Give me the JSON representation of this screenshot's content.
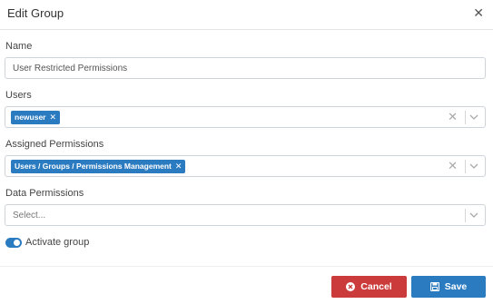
{
  "dialog": {
    "title": "Edit Group",
    "close_icon": "close-icon"
  },
  "name_field": {
    "label": "Name",
    "value": "User Restricted Permissions"
  },
  "users_field": {
    "label": "Users",
    "tags": [
      "newuser"
    ]
  },
  "permissions_field": {
    "label": "Assigned Permissions",
    "tags": [
      "Users / Groups / Permissions Management"
    ]
  },
  "data_permissions_field": {
    "label": "Data Permissions",
    "placeholder": "Select..."
  },
  "activate": {
    "label": "Activate group",
    "checked": true
  },
  "buttons": {
    "cancel_label": "Cancel",
    "save_label": "Save"
  },
  "colors": {
    "accent": "#2b7bc1",
    "danger": "#cc3b3b"
  }
}
